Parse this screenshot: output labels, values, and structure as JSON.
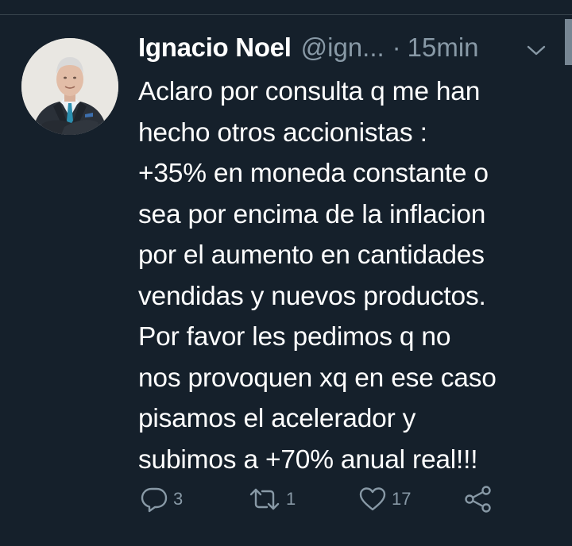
{
  "tweet": {
    "author_name": "Ignacio Noel",
    "handle": "@ign...",
    "separator": "·",
    "time": "15min",
    "text": "Aclaro por consulta q me han\nhecho otros accionistas :\n+35% en moneda constante o\nsea por encima de la inflacion\npor el aumento en cantidades\nvendidas y nuevos productos.\nPor favor les pedimos q no\nnos provoquen xq en ese caso\npisamos el acelerador y\nsubimos a +70% anual real!!!",
    "actions": {
      "reply_count": "3",
      "retweet_count": "1",
      "like_count": "17"
    }
  },
  "icons": {
    "reply": "reply-icon",
    "retweet": "retweet-icon",
    "like": "heart-icon",
    "share": "share-icon",
    "caret": "chevron-down-icon"
  },
  "colors": {
    "background": "#15202b",
    "text": "#ffffff",
    "secondary": "#8899a6",
    "divider": "#38444d"
  }
}
